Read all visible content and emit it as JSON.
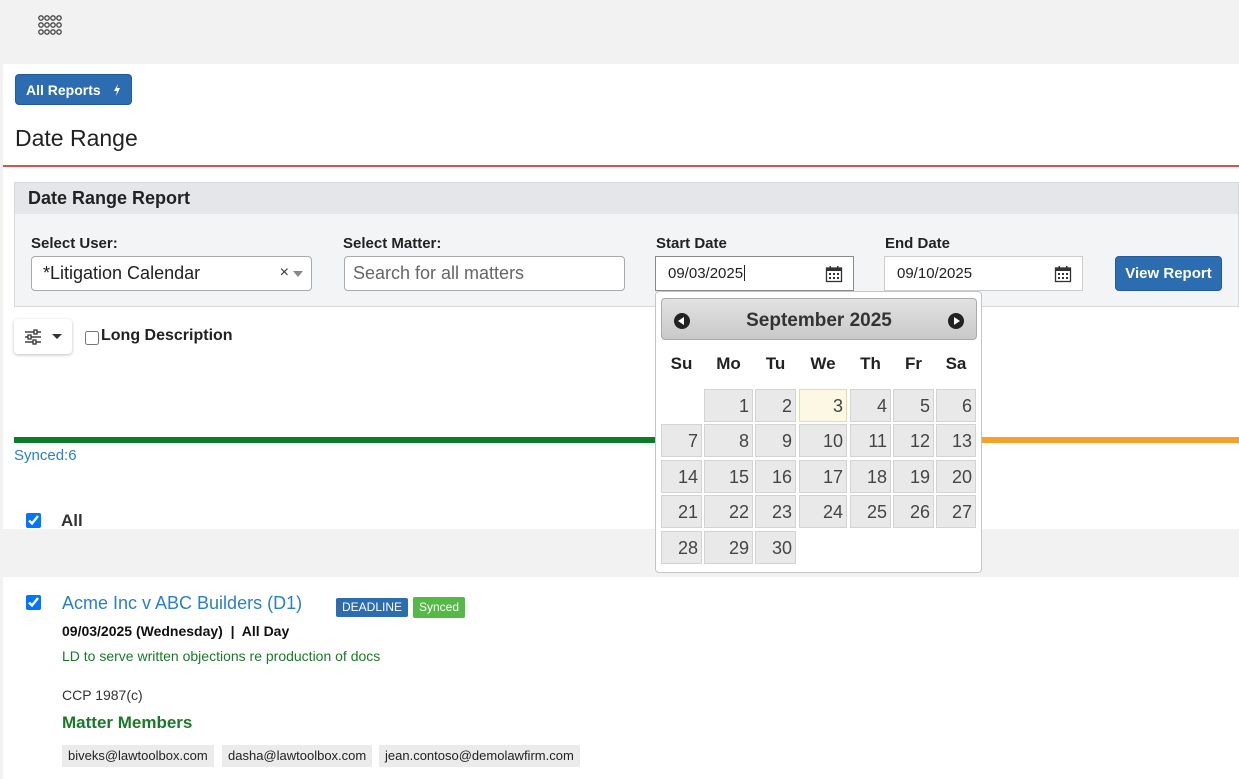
{
  "topbar": {
    "apps_icon": "apps-grid-icon"
  },
  "header": {
    "all_reports_label": "All Reports",
    "all_reports_icon": "lightning-icon",
    "page_title": "Date Range"
  },
  "report_panel": {
    "title": "Date Range Report",
    "select_user_label": "Select User:",
    "select_user_value": "*Litigation Calendar",
    "clear_symbol": "×",
    "select_matter_label": "Select Matter:",
    "select_matter_placeholder": "Search for all matters",
    "start_date_label": "Start Date",
    "start_date_value": "09/03/2025",
    "end_date_label": "End Date",
    "end_date_value": "09/10/2025",
    "view_report_label": "View Report"
  },
  "options": {
    "long_description_label": "Long Description",
    "long_description_checked": false
  },
  "sync": {
    "synced_text": "Synced:6"
  },
  "list": {
    "all_label": "All",
    "items": [
      {
        "title": "Acme Inc v ABC Builders (D1)",
        "badge_type": "DEADLINE",
        "badge_status": "Synced",
        "date": "09/03/2025 (Wednesday)  |  All Day",
        "description": "LD to serve written objections re production of docs",
        "rule": "CCP 1987(c)",
        "members_heading": "Matter Members",
        "members": [
          "biveks@lawtoolbox.com",
          "dasha@lawtoolbox.com",
          "jean.contoso@demolawfirm.com"
        ]
      }
    ]
  },
  "datepicker": {
    "month_title": "September 2025",
    "weekdays": [
      "Su",
      "Mo",
      "Tu",
      "We",
      "Th",
      "Fr",
      "Sa"
    ],
    "days": [
      "1",
      "2",
      "3",
      "4",
      "5",
      "6",
      "7",
      "8",
      "9",
      "10",
      "11",
      "12",
      "13",
      "14",
      "15",
      "16",
      "17",
      "18",
      "19",
      "20",
      "21",
      "22",
      "23",
      "24",
      "25",
      "26",
      "27",
      "28",
      "29",
      "30"
    ],
    "first_weekday": 1,
    "today": "3"
  },
  "colors": {
    "accent": "#2c6cb0",
    "link": "#2a80c9",
    "green_text": "#1a7a2a",
    "badge_synced": "#55b947",
    "progress_synced": "#0b7d2a",
    "progress_pending": "#f6a22a",
    "divider": "#d9534f"
  }
}
